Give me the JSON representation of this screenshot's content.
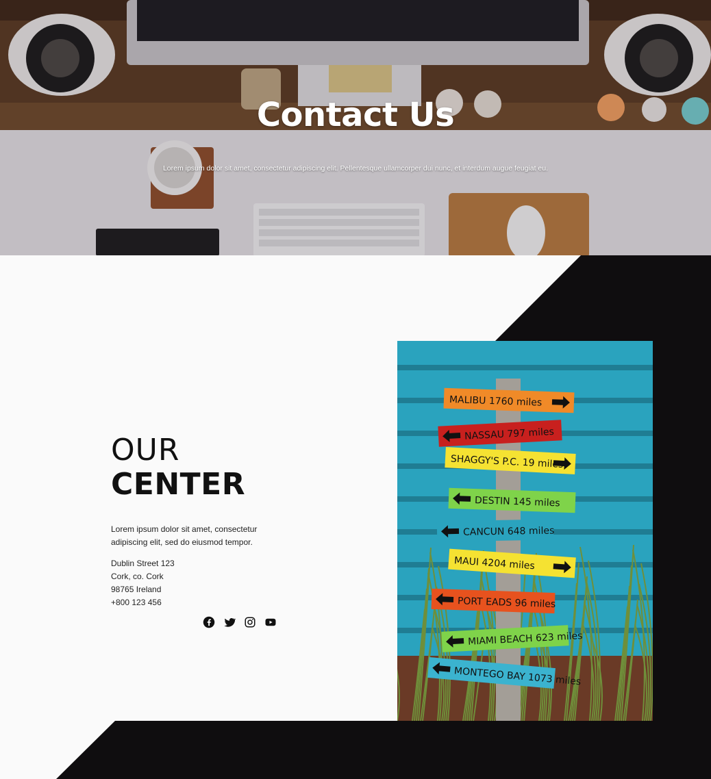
{
  "hero": {
    "title": "Contact Us",
    "subtitle": "Lorem ipsum dolor sit amet, consectetur adipiscing elit. Pellentesque ullamcorper dui nunc, et interdum augue feugiat eu."
  },
  "center": {
    "heading_line1": "OUR",
    "heading_line2": "CENTER",
    "description": "Lorem ipsum dolor sit amet, consectetur adipiscing elit, sed do eiusmod tempor.",
    "address": [
      "Dublin Street 123",
      "Cork, co. Cork",
      "98765 Ireland",
      "+800 123 456"
    ]
  },
  "social": [
    {
      "icon": "facebook-icon"
    },
    {
      "icon": "twitter-icon"
    },
    {
      "icon": "instagram-icon"
    },
    {
      "icon": "youtube-icon"
    }
  ],
  "signpost": {
    "signs": [
      "MALIBU 1760 miles",
      "NASSAU 797 miles",
      "SHAGGY'S P.C. 19 miles",
      "DESTIN 145 miles",
      "CANCUN 648 miles",
      "MAUI 4204 miles",
      "PORT EADS 96 miles",
      "MIAMI BEACH 623 miles",
      "MONTEGO BAY 1073 miles"
    ]
  },
  "colors": {
    "dark": "#0f0d0f",
    "light": "#fafafa",
    "fence": "#2aa3be"
  }
}
